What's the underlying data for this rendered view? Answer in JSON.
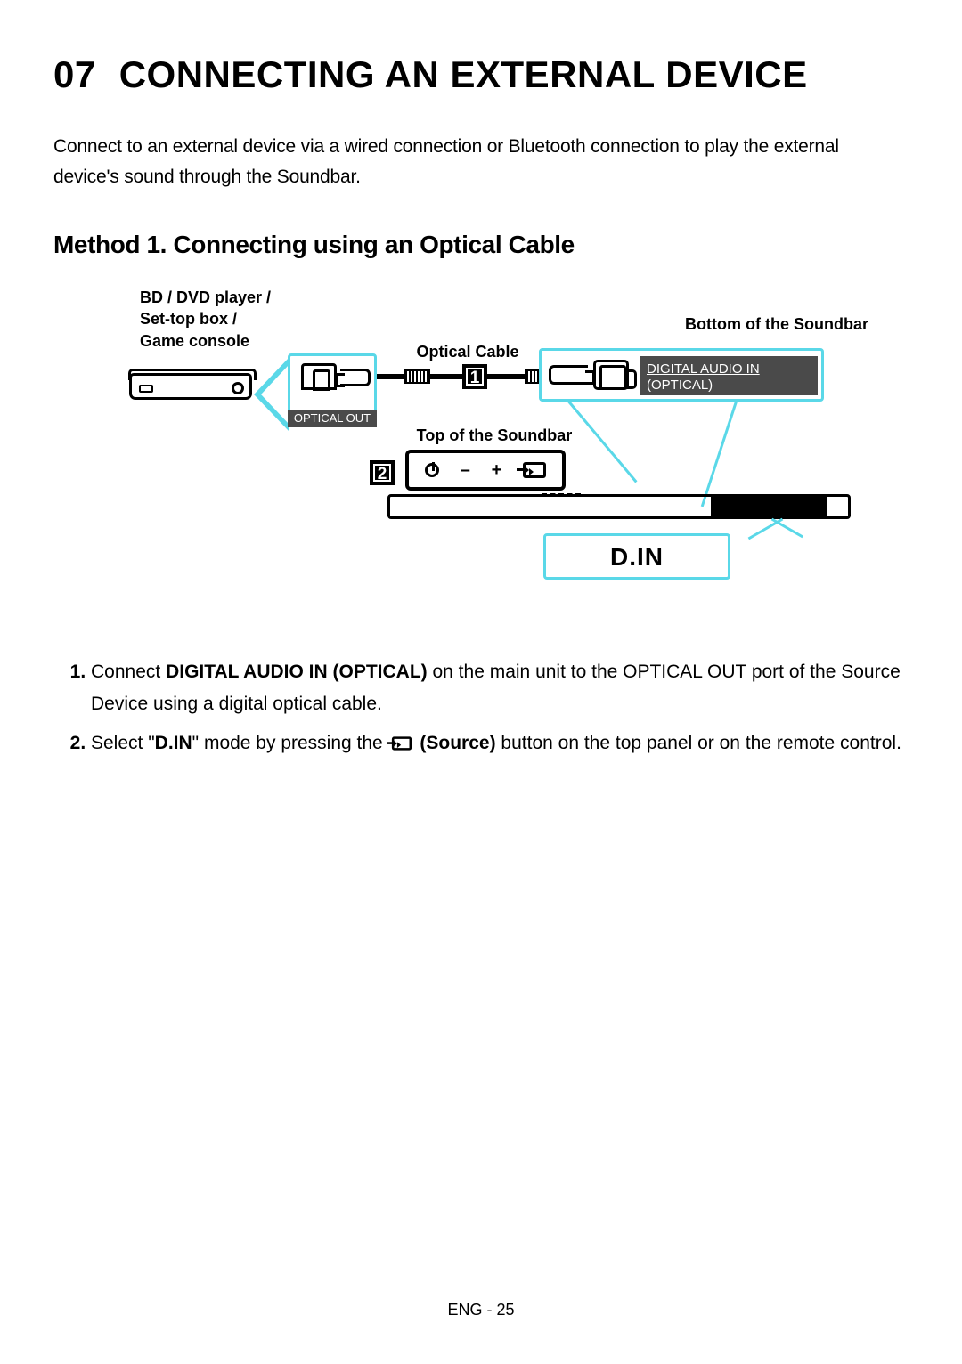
{
  "header": {
    "section_number": "07",
    "title": "CONNECTING AN EXTERNAL DEVICE"
  },
  "intro": "Connect to an external device via a wired connection or Bluetooth connection to play the external device's sound through the Soundbar.",
  "method_heading": "Method 1. Connecting using an Optical Cable",
  "diagram": {
    "source_device_label": "BD / DVD player /\nSet-top box /\nGame console",
    "optical_cable_label": "Optical Cable",
    "bottom_label": "Bottom of the Soundbar",
    "top_label": "Top of the Soundbar",
    "optical_out_tag": "OPTICAL OUT",
    "digital_audio_in_line1": "DIGITAL AUDIO IN",
    "digital_audio_in_line2": "(OPTICAL)",
    "badge1": "1",
    "badge2": "2",
    "display_text": "D.IN",
    "top_panel_minus": "–",
    "top_panel_plus": "+"
  },
  "steps": {
    "s1_prefix": "Connect ",
    "s1_bold": "DIGITAL AUDIO IN (OPTICAL)",
    "s1_suffix": " on the main unit to the OPTICAL OUT port of the Source Device using a digital optical cable.",
    "s2_prefix": "Select \"",
    "s2_bold1": "D.IN",
    "s2_mid1": "\" mode by pressing the ",
    "s2_bold2": "(Source)",
    "s2_suffix": " button on the top panel or on the remote control."
  },
  "footer": "ENG - 25"
}
